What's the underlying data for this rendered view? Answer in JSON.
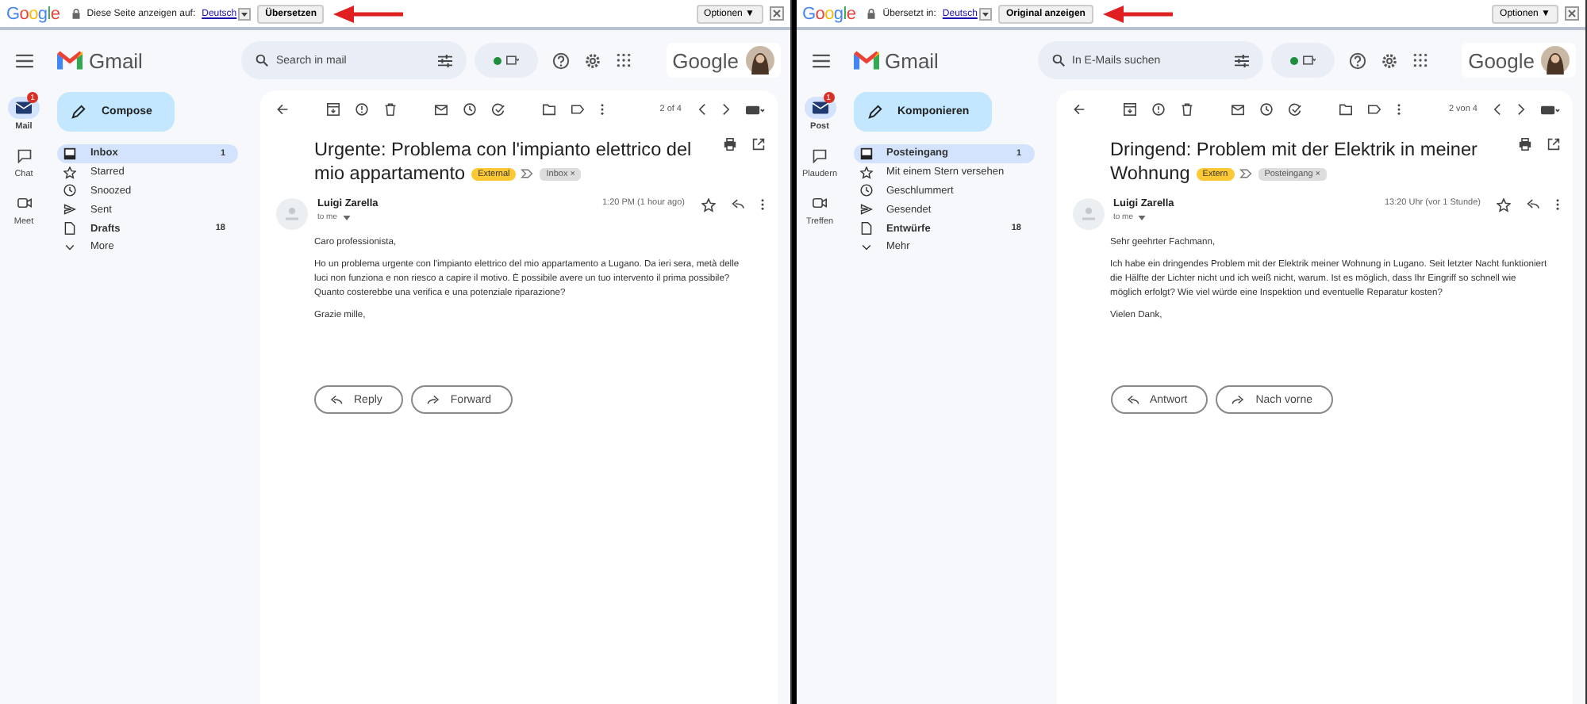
{
  "panes": [
    {
      "translate_bar": {
        "logo": "Google",
        "message": "Diese Seite anzeigen auf:",
        "language": "Deutsch",
        "action": "Übersetzen",
        "options": "Optionen ▼"
      },
      "header": {
        "app_name": "Gmail",
        "search_placeholder": "Search in mail",
        "account": "Google"
      },
      "rail": [
        {
          "kind": "mail",
          "label": "Mail",
          "badge": "1",
          "selected": true
        },
        {
          "kind": "chat",
          "label": "Chat",
          "selected": false
        },
        {
          "kind": "meet",
          "label": "Meet",
          "selected": false
        }
      ],
      "compose": "Compose",
      "folders": [
        {
          "kind": "inbox",
          "label": "Inbox",
          "count": "1",
          "selected": true,
          "unread": true
        },
        {
          "kind": "star",
          "label": "Starred",
          "selected": false,
          "unread": false
        },
        {
          "kind": "clock",
          "label": "Snoozed",
          "selected": false,
          "unread": false
        },
        {
          "kind": "sent",
          "label": "Sent",
          "selected": false,
          "unread": false
        },
        {
          "kind": "draft",
          "label": "Drafts",
          "count": "18",
          "selected": false,
          "unread": true
        },
        {
          "kind": "more",
          "label": "More",
          "selected": false,
          "unread": false
        }
      ],
      "counter": "2 of 4",
      "email": {
        "subject": "Urgente: Problema con l'impianto elettrico del mio appartamento",
        "tags": [
          {
            "kind": "external",
            "label": "External"
          },
          {
            "kind": "folder",
            "label": "Inbox ×"
          }
        ],
        "sender": "Luigi Zarella",
        "recipient": "to me",
        "time": "1:20 PM (1 hour ago)",
        "paragraphs": [
          "Caro professionista,",
          "Ho un problema urgente con l'impianto elettrico del mio appartamento a Lugano. Da ieri sera, metà delle luci non funziona e non riesco a capire il motivo. È possibile avere un tuo intervento il prima possibile? Quanto costerebbe una verifica e una potenziale riparazione?",
          "Grazie mille,"
        ],
        "reply": "Reply",
        "forward": "Forward"
      }
    },
    {
      "translate_bar": {
        "logo": "Google",
        "message": "Übersetzt in:",
        "language": "Deutsch",
        "action": "Original anzeigen",
        "options": "Optionen ▼"
      },
      "header": {
        "app_name": "Gmail",
        "search_placeholder": "In E-Mails suchen",
        "account": "Google"
      },
      "rail": [
        {
          "kind": "mail",
          "label": "Post",
          "badge": "1",
          "selected": true
        },
        {
          "kind": "chat",
          "label": "Plaudern",
          "selected": false
        },
        {
          "kind": "meet",
          "label": "Treffen",
          "selected": false
        }
      ],
      "compose": "Komponieren",
      "folders": [
        {
          "kind": "inbox",
          "label": "Posteingang",
          "count": "1",
          "selected": true,
          "unread": true
        },
        {
          "kind": "star",
          "label": "Mit einem Stern versehen",
          "selected": false,
          "unread": false
        },
        {
          "kind": "clock",
          "label": "Geschlummert",
          "selected": false,
          "unread": false
        },
        {
          "kind": "sent",
          "label": "Gesendet",
          "selected": false,
          "unread": false
        },
        {
          "kind": "draft",
          "label": "Entwürfe",
          "count": "18",
          "selected": false,
          "unread": true
        },
        {
          "kind": "more",
          "label": "Mehr",
          "selected": false,
          "unread": false
        }
      ],
      "counter": "2 von 4",
      "email": {
        "subject": "Dringend: Problem mit der Elektrik in meiner Wohnung",
        "tags": [
          {
            "kind": "external",
            "label": "Extern"
          },
          {
            "kind": "folder",
            "label": "Posteingang ×"
          }
        ],
        "sender": "Luigi Zarella",
        "recipient": "to me",
        "time": "13:20 Uhr (vor 1 Stunde)",
        "paragraphs": [
          "Sehr geehrter Fachmann,",
          "Ich habe ein dringendes Problem mit der Elektrik meiner Wohnung in Lugano. Seit letzter Nacht funktioniert die Hälfte der Lichter nicht und ich weiß nicht, warum. Ist es möglich, dass Ihr Eingriff so schnell wie möglich erfolgt? Wie viel würde eine Inspektion und eventuelle Reparatur kosten?",
          "Vielen Dank,"
        ],
        "reply": "Antwort",
        "forward": "Nach vorne"
      }
    }
  ]
}
